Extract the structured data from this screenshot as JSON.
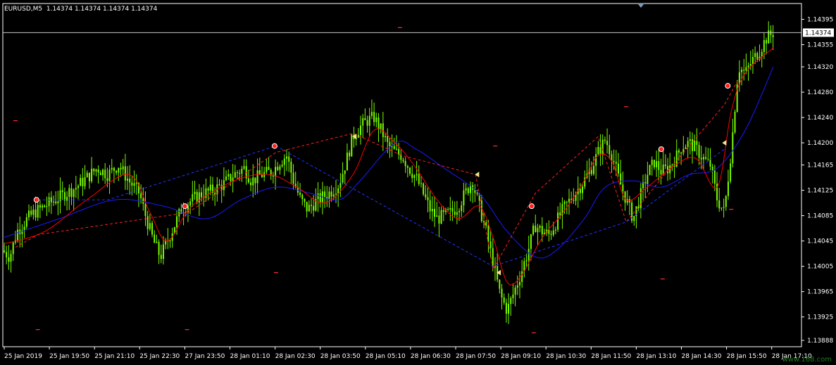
{
  "header": {
    "symbol": "EURUSD,M5",
    "ohlc": "1.14374 1.14374 1.14374 1.14374"
  },
  "watermark": "www.168.com",
  "colors": {
    "background": "#000000",
    "candle": "#7CFC00",
    "axis_text": "#ffffff",
    "ma_red": "#ff0000",
    "ma_blue": "#1a1aff",
    "zigzag_red": "#ff2020",
    "zigzag_blue": "#2233ff",
    "price_line": "#c8c8c8",
    "watermark": "#1f7a1f"
  },
  "chart_data": {
    "type": "candlestick",
    "symbol": "EURUSD",
    "timeframe": "M5",
    "current_price": "1.14374",
    "ylim": [
      1.13878,
      1.1442
    ],
    "y_ticks": [
      "1.14395",
      "1.14355",
      "1.14320",
      "1.14280",
      "1.14240",
      "1.14200",
      "1.14165",
      "1.14125",
      "1.14085",
      "1.14045",
      "1.14005",
      "1.13965",
      "1.13925",
      "1.13888"
    ],
    "x_ticks": [
      "25 Jan 2019",
      "25 Jan 19:50",
      "25 Jan 21:10",
      "25 Jan 22:30",
      "27 Jan 23:50",
      "28 Jan 01:10",
      "28 Jan 02:30",
      "28 Jan 03:50",
      "28 Jan 05:10",
      "28 Jan 06:30",
      "28 Jan 07:50",
      "28 Jan 09:10",
      "28 Jan 10:30",
      "28 Jan 11:50",
      "28 Jan 13:10",
      "28 Jan 14:30",
      "28 Jan 15:50",
      "28 Jan 17:10"
    ],
    "price_path": {
      "x": [
        0,
        10,
        20,
        35,
        45,
        60,
        75,
        90,
        105,
        120,
        135,
        150,
        165,
        180,
        195,
        205,
        215,
        225,
        235,
        245,
        255,
        270,
        285,
        300,
        315,
        330,
        345,
        355,
        370,
        385,
        395,
        405,
        415,
        425,
        435,
        450,
        465,
        480,
        490,
        500,
        510,
        520,
        530,
        540,
        550,
        560,
        570,
        580,
        590,
        600,
        610,
        620,
        630,
        640,
        650,
        660,
        670,
        680,
        690,
        700,
        710,
        720,
        730,
        740,
        750,
        760,
        770,
        780,
        790,
        800,
        810,
        820,
        830,
        840,
        850,
        860,
        870,
        880,
        890,
        900,
        910,
        920,
        930,
        940,
        950,
        960,
        970,
        980,
        990,
        1000,
        1010,
        1020,
        1030,
        1040,
        1050,
        1060,
        1070,
        1080,
        1090,
        1100
      ],
      "y": [
        1.1403,
        1.1402,
        1.1406,
        1.1408,
        1.1409,
        1.141,
        1.1411,
        1.1412,
        1.1413,
        1.14145,
        1.1416,
        1.1415,
        1.14165,
        1.1414,
        1.1412,
        1.1408,
        1.14045,
        1.1402,
        1.14045,
        1.1407,
        1.14095,
        1.1411,
        1.1412,
        1.14125,
        1.14135,
        1.1415,
        1.1416,
        1.1414,
        1.1415,
        1.14155,
        1.1417,
        1.1418,
        1.1414,
        1.1411,
        1.14095,
        1.1411,
        1.1412,
        1.14135,
        1.1417,
        1.1421,
        1.14225,
        1.14235,
        1.1424,
        1.1422,
        1.14195,
        1.14185,
        1.1418,
        1.1416,
        1.14145,
        1.1412,
        1.14095,
        1.1408,
        1.14085,
        1.1409,
        1.141,
        1.1412,
        1.1414,
        1.141,
        1.1406,
        1.1401,
        1.1396,
        1.13935,
        1.13965,
        1.13995,
        1.1403,
        1.1407,
        1.1406,
        1.14055,
        1.14075,
        1.14095,
        1.1411,
        1.14125,
        1.1414,
        1.1416,
        1.14185,
        1.14205,
        1.1418,
        1.1414,
        1.1411,
        1.1408,
        1.14115,
        1.1415,
        1.1417,
        1.14155,
        1.1416,
        1.14175,
        1.14195,
        1.142,
        1.1419,
        1.14175,
        1.14165,
        1.1411,
        1.1409,
        1.1419,
        1.1432,
        1.1431,
        1.1433,
        1.14345,
        1.14365,
        1.14374
      ]
    },
    "zigzag_red": [
      [
        18,
        1.14035
      ],
      [
        50,
        1.14055
      ],
      [
        265,
        1.1409
      ],
      [
        390,
        1.14185
      ],
      [
        500,
        1.14215
      ],
      [
        570,
        1.1418
      ],
      [
        675,
        1.1415
      ],
      [
        700,
        1.14
      ],
      [
        760,
        1.1412
      ],
      [
        850,
        1.1421
      ],
      [
        890,
        1.14075
      ],
      [
        945,
        1.1415
      ],
      [
        1030,
        1.1426
      ],
      [
        1050,
        1.143
      ]
    ],
    "zigzag_blue": [
      [
        50,
        1.1411
      ],
      [
        150,
        1.1411
      ],
      [
        390,
        1.14195
      ],
      [
        700,
        1.14005
      ],
      [
        890,
        1.14075
      ],
      [
        1030,
        1.1419
      ]
    ],
    "ma_red": [
      [
        0,
        1.1404
      ],
      [
        60,
        1.1406
      ],
      [
        120,
        1.1411
      ],
      [
        180,
        1.1415
      ],
      [
        210,
        1.1409
      ],
      [
        235,
        1.14045
      ],
      [
        270,
        1.141
      ],
      [
        330,
        1.1414
      ],
      [
        380,
        1.1415
      ],
      [
        420,
        1.1413
      ],
      [
        460,
        1.14105
      ],
      [
        500,
        1.1415
      ],
      [
        530,
        1.1422
      ],
      [
        560,
        1.142
      ],
      [
        590,
        1.1416
      ],
      [
        620,
        1.1411
      ],
      [
        650,
        1.1408
      ],
      [
        680,
        1.141
      ],
      [
        700,
        1.1405
      ],
      [
        720,
        1.1398
      ],
      [
        740,
        1.1399
      ],
      [
        770,
        1.1405
      ],
      [
        800,
        1.1409
      ],
      [
        830,
        1.1414
      ],
      [
        850,
        1.1418
      ],
      [
        870,
        1.1417
      ],
      [
        890,
        1.1411
      ],
      [
        920,
        1.1413
      ],
      [
        960,
        1.14165
      ],
      [
        990,
        1.14175
      ],
      [
        1020,
        1.1413
      ],
      [
        1040,
        1.1425
      ],
      [
        1060,
        1.1431
      ],
      [
        1100,
        1.1435
      ]
    ],
    "ma_blue": [
      [
        0,
        1.1405
      ],
      [
        80,
        1.1408
      ],
      [
        160,
        1.1411
      ],
      [
        230,
        1.141
      ],
      [
        290,
        1.1408
      ],
      [
        340,
        1.1411
      ],
      [
        390,
        1.1413
      ],
      [
        440,
        1.1412
      ],
      [
        480,
        1.1411
      ],
      [
        510,
        1.1414
      ],
      [
        560,
        1.142
      ],
      [
        590,
        1.1419
      ],
      [
        630,
        1.1416
      ],
      [
        680,
        1.1412
      ],
      [
        720,
        1.1406
      ],
      [
        760,
        1.1402
      ],
      [
        790,
        1.1403
      ],
      [
        830,
        1.1408
      ],
      [
        860,
        1.1413
      ],
      [
        900,
        1.1414
      ],
      [
        940,
        1.1413
      ],
      [
        980,
        1.1415
      ],
      [
        1020,
        1.1416
      ],
      [
        1060,
        1.1422
      ],
      [
        1100,
        1.1432
      ]
    ],
    "markers_red": [
      [
        48,
        1.1411
      ],
      [
        260,
        1.141
      ],
      [
        388,
        1.14195
      ],
      [
        755,
        1.141
      ],
      [
        940,
        1.1419
      ],
      [
        1035,
        1.1429
      ]
    ],
    "markers_yellow": [
      [
        502,
        1.1421
      ],
      [
        677,
        1.1415
      ],
      [
        708,
        1.13995
      ],
      [
        1030,
        1.142
      ]
    ],
    "dashes": [
      [
        18,
        1.14235
      ],
      [
        50,
        1.13905
      ],
      [
        263,
        1.13905
      ],
      [
        390,
        1.13995
      ],
      [
        567,
        1.14382
      ],
      [
        703,
        1.14195
      ],
      [
        758,
        1.139
      ],
      [
        890,
        1.14257
      ],
      [
        942,
        1.13985
      ],
      [
        1040,
        1.14095
      ]
    ]
  }
}
